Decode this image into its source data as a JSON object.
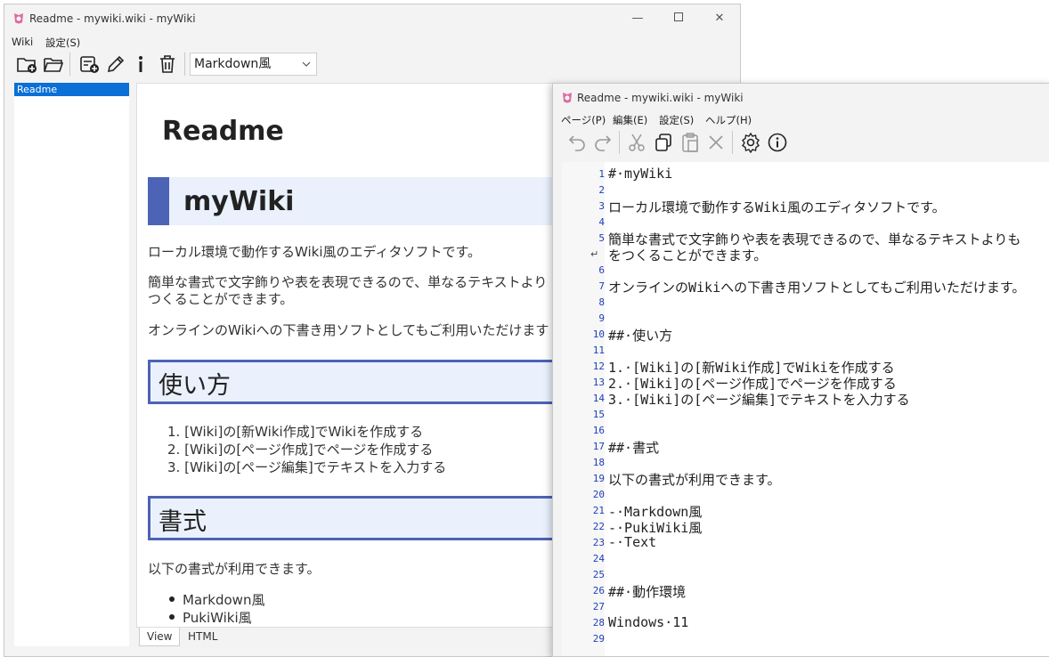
{
  "main_window": {
    "title": "Readme - mywiki.wiki - myWiki",
    "menu": [
      "Wiki",
      "設定(S)"
    ],
    "format_select": "Markdown風",
    "pages": [
      "Readme"
    ],
    "tabs": [
      "View",
      "HTML"
    ]
  },
  "view": {
    "page_title": "Readme",
    "h2": "myWiki",
    "p1": "ローカル環境で動作するWiki風のエディタソフトです。",
    "p2a": "簡単な書式で文字飾りや表を表現できるので、単なるテキストより",
    "p2b": "つくることができます。",
    "p3": "オンラインのWikiへの下書き用ソフトとしてもご利用いただけます",
    "h3_usage": "使い方",
    "steps": [
      "[Wiki]の[新Wiki作成]でWikiを作成する",
      "[Wiki]の[ページ作成]でページを作成する",
      "[Wiki]の[ページ編集]でテキストを入力する"
    ],
    "h3_format": "書式",
    "p4": "以下の書式が利用できます。",
    "formats": [
      "Markdown風",
      "PukiWiki風"
    ]
  },
  "editor_window": {
    "title": "Readme - mywiki.wiki - myWiki",
    "menu": [
      "ページ(P)",
      "編集(E)",
      "設定(S)",
      "ヘルプ(H)"
    ],
    "lines": [
      {
        "n": "1",
        "t": "#·myWiki"
      },
      {
        "n": "2",
        "t": ""
      },
      {
        "n": "3",
        "t": "ローカル環境で動作するWiki風のエディタソフトです。"
      },
      {
        "n": "4",
        "t": ""
      },
      {
        "n": "5",
        "t": "簡単な書式で文字飾りや表を表現できるので、単なるテキストよりも"
      },
      {
        "n": "",
        "t": "をつくることができます。"
      },
      {
        "n": "6",
        "t": ""
      },
      {
        "n": "7",
        "t": "オンラインのWikiへの下書き用ソフトとしてもご利用いただけます。"
      },
      {
        "n": "8",
        "t": ""
      },
      {
        "n": "9",
        "t": ""
      },
      {
        "n": "10",
        "t": "##·使い方"
      },
      {
        "n": "11",
        "t": ""
      },
      {
        "n": "12",
        "t": "1.·[Wiki]の[新Wiki作成]でWikiを作成する"
      },
      {
        "n": "13",
        "t": "2.·[Wiki]の[ページ作成]でページを作成する"
      },
      {
        "n": "14",
        "t": "3.·[Wiki]の[ページ編集]でテキストを入力する"
      },
      {
        "n": "15",
        "t": ""
      },
      {
        "n": "16",
        "t": ""
      },
      {
        "n": "17",
        "t": "##·書式"
      },
      {
        "n": "18",
        "t": ""
      },
      {
        "n": "19",
        "t": "以下の書式が利用できます。"
      },
      {
        "n": "20",
        "t": ""
      },
      {
        "n": "21",
        "t": "-·Markdown風"
      },
      {
        "n": "22",
        "t": "-·PukiWiki風"
      },
      {
        "n": "23",
        "t": "-·Text"
      },
      {
        "n": "24",
        "t": ""
      },
      {
        "n": "25",
        "t": ""
      },
      {
        "n": "26",
        "t": "##·動作環境"
      },
      {
        "n": "27",
        "t": ""
      },
      {
        "n": "28",
        "t": "Windows·11"
      },
      {
        "n": "29",
        "t": ""
      }
    ]
  }
}
